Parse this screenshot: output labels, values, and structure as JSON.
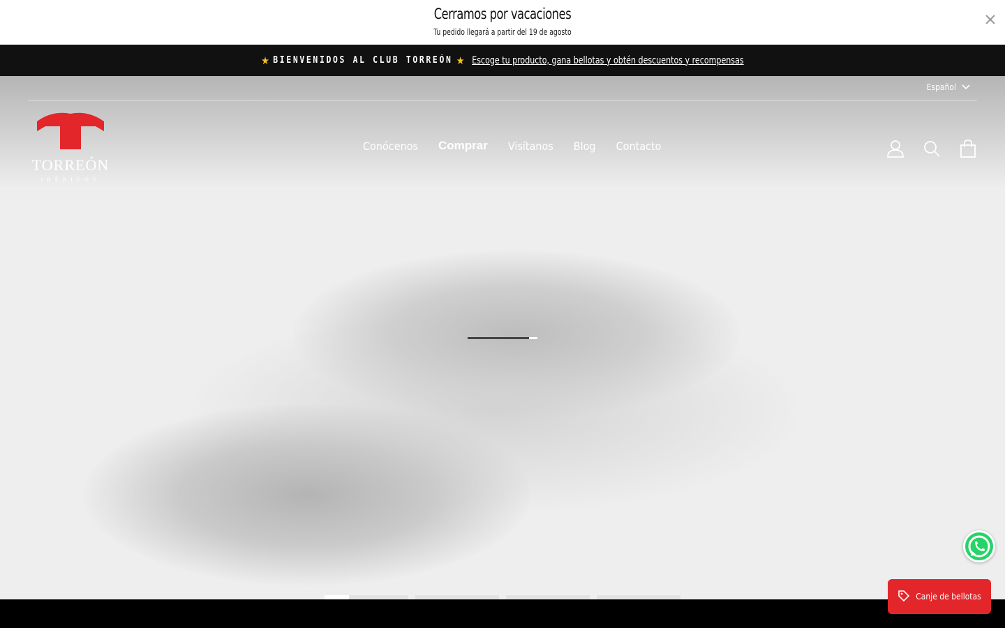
{
  "announcement": {
    "title": "Cerramos por vacaciones",
    "subtitle": "Tu pedido llegará a partir del 19 de agosto"
  },
  "club_bar": {
    "welcome": "BIENVENIDOS AL CLUB TORREÓN",
    "link_text": "Escoge tu producto, gana bellotas y obtén descuentos y recompensas"
  },
  "header": {
    "language": "Español",
    "logo_text": "TORREÓN",
    "logo_subtext": "IBÉRICOS",
    "nav": [
      "Conócenos",
      "Comprar",
      "Visítanos",
      "Blog",
      "Contacto"
    ]
  },
  "hero": {
    "loader_progress": 0.88,
    "slides": 4,
    "active_slide": 0
  },
  "widgets": {
    "bellotas_label": "Canje de bellotas"
  },
  "colors": {
    "brand_red": "#e3262a",
    "dark_bar": "#111111",
    "star": "#f4c21f"
  },
  "icons": [
    "close-icon",
    "star-icon",
    "chevron-down-icon",
    "user-icon",
    "search-icon",
    "cart-icon",
    "whatsapp-icon",
    "tag-icon"
  ]
}
